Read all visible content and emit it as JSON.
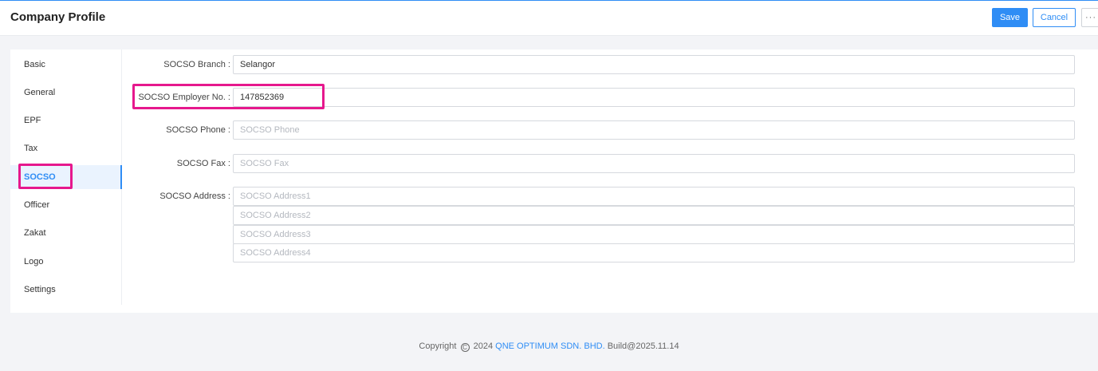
{
  "header": {
    "title": "Company Profile",
    "save_label": "Save",
    "cancel_label": "Cancel",
    "more_label": "···"
  },
  "sidebar": {
    "items": [
      {
        "label": "Basic"
      },
      {
        "label": "General"
      },
      {
        "label": "EPF"
      },
      {
        "label": "Tax"
      },
      {
        "label": "SOCSO",
        "active": true
      },
      {
        "label": "Officer"
      },
      {
        "label": "Zakat"
      },
      {
        "label": "Logo"
      },
      {
        "label": "Settings"
      }
    ]
  },
  "form": {
    "branch": {
      "label": "SOCSO Branch :",
      "value": "Selangor"
    },
    "employer_no": {
      "label": "SOCSO Employer No. :",
      "value": "147852369"
    },
    "phone": {
      "label": "SOCSO Phone :",
      "placeholder": "SOCSO Phone"
    },
    "fax": {
      "label": "SOCSO Fax :",
      "placeholder": "SOCSO Fax"
    },
    "address": {
      "label": "SOCSO Address :",
      "placeholders": [
        "SOCSO Address1",
        "SOCSO Address2",
        "SOCSO Address3",
        "SOCSO Address4"
      ]
    }
  },
  "footer": {
    "copyright_prefix": "Copyright",
    "copyright_symbol": "C",
    "year": "2024",
    "company": "QNE OPTIMUM SDN. BHD.",
    "build": "Build@2025.11.14"
  },
  "colors": {
    "accent": "#2f8df5",
    "highlight": "#e6188d"
  }
}
